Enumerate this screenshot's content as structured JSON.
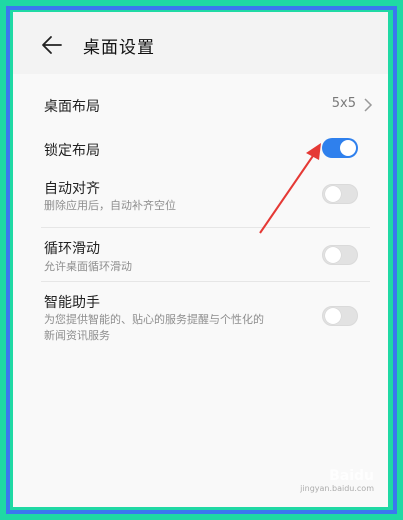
{
  "header": {
    "title": "桌面设置"
  },
  "settings": {
    "desktop_layout": {
      "title": "桌面布局",
      "value": "5x5"
    },
    "lock_layout": {
      "title": "锁定布局",
      "enabled": true
    },
    "auto_align": {
      "title": "自动对齐",
      "subtitle": "删除应用后，自动补齐空位",
      "enabled": false
    },
    "loop_scroll": {
      "title": "循环滑动",
      "subtitle": "允许桌面循环滑动",
      "enabled": false
    },
    "smart_assistant": {
      "title": "智能助手",
      "subtitle_line1": "为您提供智能的、贴心的服务提醒与个性化的",
      "subtitle_line2": "新闻资讯服务",
      "enabled": false
    }
  },
  "watermark": {
    "brand": "Baidu",
    "sub": "jingyan.baidu.com"
  },
  "colors": {
    "accent": "#2f80ed",
    "annotation_arrow": "#e53935",
    "frame": "#1fd9a4"
  }
}
